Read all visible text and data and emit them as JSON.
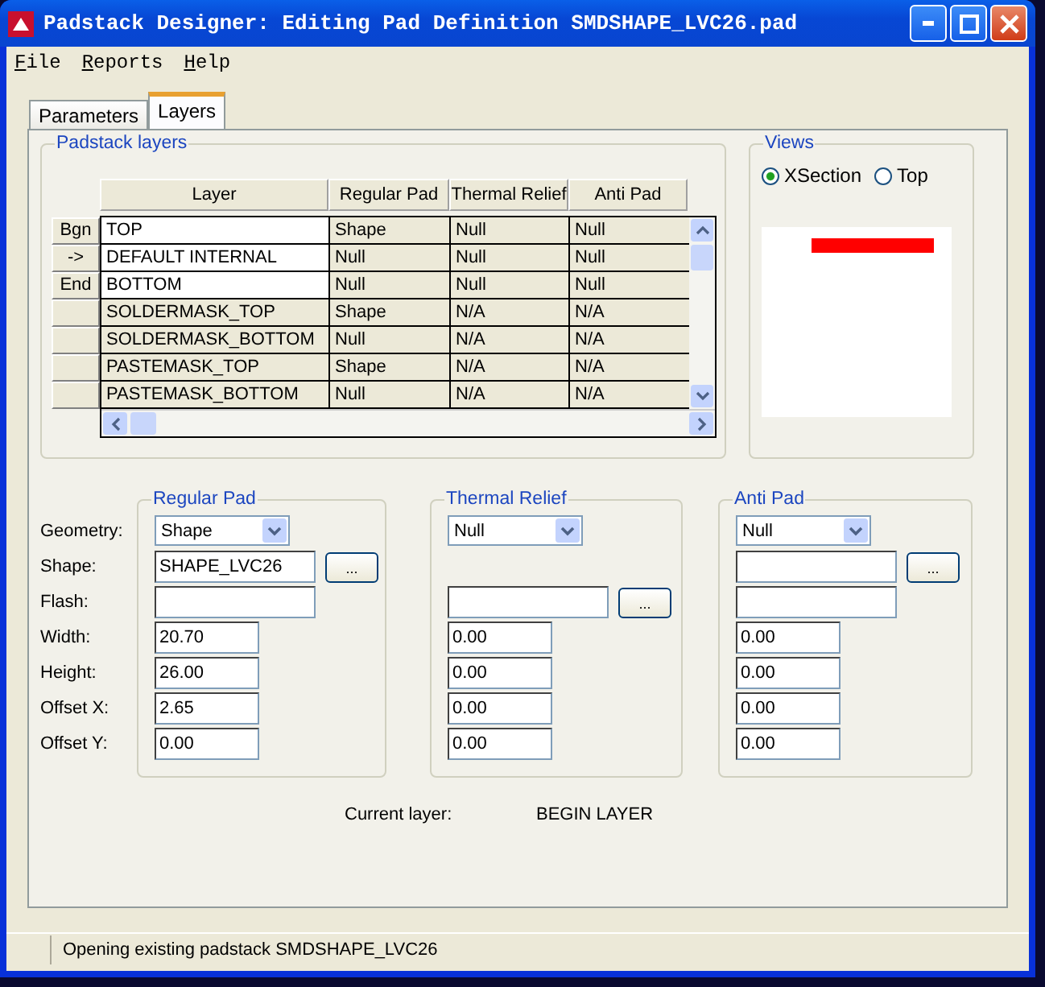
{
  "window": {
    "title": "Padstack Designer: Editing Pad Definition SMDSHAPE_LVC26.pad"
  },
  "menu": [
    "File",
    "Reports",
    "Help"
  ],
  "tabs": [
    {
      "label": "Parameters",
      "selected": false
    },
    {
      "label": "Layers",
      "selected": true
    }
  ],
  "padstack_layers": {
    "title": "Padstack layers",
    "columns": [
      "Layer",
      "Regular Pad",
      "Thermal Relief",
      "Anti Pad"
    ],
    "rows": [
      {
        "marker": "Bgn",
        "kind": "etch",
        "cells": [
          "TOP",
          "Shape",
          "Null",
          "Null"
        ]
      },
      {
        "marker": "->",
        "kind": "etch",
        "cells": [
          "DEFAULT INTERNAL",
          "Null",
          "Null",
          "Null"
        ]
      },
      {
        "marker": "End",
        "kind": "etch",
        "cells": [
          "BOTTOM",
          "Null",
          "Null",
          "Null"
        ]
      },
      {
        "kind": "mask",
        "cells": [
          "SOLDERMASK_TOP",
          "Shape",
          "N/A",
          "N/A"
        ]
      },
      {
        "kind": "mask",
        "cells": [
          "SOLDERMASK_BOTTOM",
          "Null",
          "N/A",
          "N/A"
        ]
      },
      {
        "kind": "mask",
        "cells": [
          "PASTEMASK_TOP",
          "Shape",
          "N/A",
          "N/A"
        ]
      },
      {
        "kind": "mask",
        "cells": [
          "PASTEMASK_BOTTOM",
          "Null",
          "N/A",
          "N/A"
        ]
      }
    ]
  },
  "views": {
    "title": "Views",
    "options": [
      {
        "label": "XSection",
        "selected": true
      },
      {
        "label": "Top",
        "selected": false
      }
    ]
  },
  "field_labels": [
    "Geometry:",
    "Shape:",
    "Flash:",
    "Width:",
    "Height:",
    "Offset X:",
    "Offset Y:"
  ],
  "pad_groups": [
    {
      "title": "Regular Pad",
      "fields": [
        {
          "kind": "select",
          "value": "Shape"
        },
        {
          "kind": "text",
          "value": "SHAPE_LVC26",
          "button": "..."
        },
        {
          "kind": "text"
        },
        {
          "kind": "number",
          "value": "20.70"
        },
        {
          "kind": "number",
          "value": "26.00"
        },
        {
          "kind": "number",
          "value": "2.65"
        },
        {
          "kind": "number",
          "value": "0.00"
        }
      ]
    },
    {
      "title": "Thermal Relief",
      "fields": [
        {
          "kind": "select",
          "value": "Null"
        },
        {
          "kind": "blank"
        },
        {
          "kind": "text",
          "button": "..."
        },
        {
          "kind": "number",
          "value": "0.00"
        },
        {
          "kind": "number",
          "value": "0.00"
        },
        {
          "kind": "number",
          "value": "0.00"
        },
        {
          "kind": "number",
          "value": "0.00"
        }
      ]
    },
    {
      "title": "Anti Pad",
      "fields": [
        {
          "kind": "select",
          "value": "Null"
        },
        {
          "kind": "text",
          "button": "..."
        },
        {
          "kind": "text"
        },
        {
          "kind": "number",
          "value": "0.00"
        },
        {
          "kind": "number",
          "value": "0.00"
        },
        {
          "kind": "number",
          "value": "0.00"
        },
        {
          "kind": "number",
          "value": "0.00"
        }
      ]
    }
  ],
  "current_layer": {
    "label": "Current layer:",
    "value": "BEGIN LAYER"
  },
  "status_bar": "Opening existing padstack SMDSHAPE_LVC26"
}
